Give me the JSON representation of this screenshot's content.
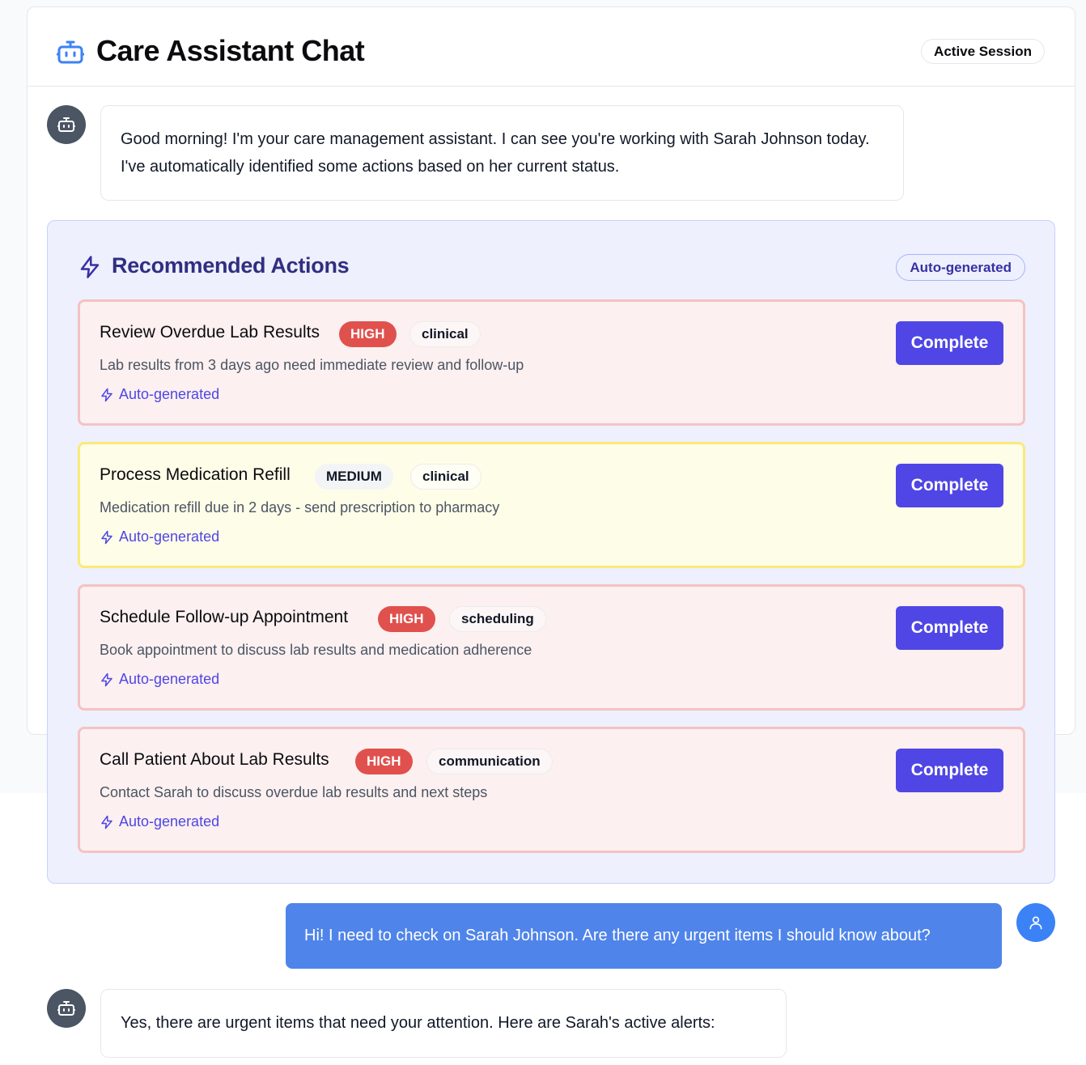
{
  "header": {
    "title": "Care Assistant Chat",
    "session_badge": "Active Session"
  },
  "messages": [
    {
      "role": "assistant",
      "text": "Good morning! I'm your care management assistant. I can see you're working with Sarah Johnson today. I've automatically identified some actions based on her current status."
    },
    {
      "role": "user",
      "text": "Hi! I need to check on Sarah Johnson. Are there any urgent items I should know about?"
    },
    {
      "role": "assistant",
      "text": "Yes, there are urgent items that need your attention. Here are Sarah's active alerts:"
    }
  ],
  "recommended_actions": {
    "title": "Recommended Actions",
    "badge": "Auto-generated",
    "items": [
      {
        "title": "Review Overdue Lab Results",
        "priority": "HIGH",
        "category": "clinical",
        "description": "Lab results from 3 days ago need immediate review and follow-up",
        "source": "Auto-generated",
        "button": "Complete"
      },
      {
        "title": "Process Medication Refill",
        "priority": "MEDIUM",
        "category": "clinical",
        "description": "Medication refill due in 2 days - send prescription to pharmacy",
        "source": "Auto-generated",
        "button": "Complete"
      },
      {
        "title": "Schedule Follow-up Appointment",
        "priority": "HIGH",
        "category": "scheduling",
        "description": "Book appointment to discuss lab results and medication adherence",
        "source": "Auto-generated",
        "button": "Complete"
      },
      {
        "title": "Call Patient About Lab Results",
        "priority": "HIGH",
        "category": "communication",
        "description": "Contact Sarah to discuss overdue lab results and next steps",
        "source": "Auto-generated",
        "button": "Complete"
      }
    ]
  },
  "colors": {
    "accent": "#4f46e5",
    "high": "#e0514e",
    "user_bubble": "#4f84ea",
    "bot_avatar": "#4b5563"
  }
}
